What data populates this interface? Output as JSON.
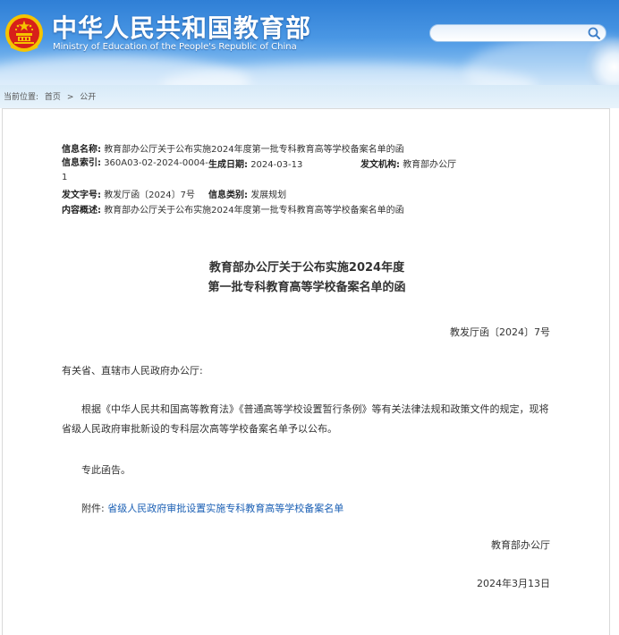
{
  "header": {
    "site_name_cn": "中华人民共和国教育部",
    "site_name_en": "Ministry of Education of the People's Republic of China",
    "search_placeholder": "",
    "search_icon": "magnifier-icon",
    "emblem_icon": "national-emblem-icon"
  },
  "breadcrumb": {
    "label": "当前位置:",
    "items": [
      "首页",
      "公开"
    ],
    "separator": ">"
  },
  "meta": {
    "name_label": "信息名称:",
    "name_value": "教育部办公厅关于公布实施2024年度第一批专科教育高等学校备案名单的函",
    "index_label": "信息索引:",
    "index_value": "360A03-02-2024-0004-1",
    "date_label": "生成日期:",
    "date_value": "2024-03-13",
    "org_label": "发文机构:",
    "org_value": "教育部办公厅",
    "docno_label": "发文字号:",
    "docno_value": "教发厅函〔2024〕7号",
    "category_label": "信息类别:",
    "category_value": "发展规划",
    "summary_label": "内容概述:",
    "summary_value": "教育部办公厅关于公布实施2024年度第一批专科教育高等学校备案名单的函"
  },
  "article": {
    "title_line1": "教育部办公厅关于公布实施2024年度",
    "title_line2": "第一批专科教育高等学校备案名单的函",
    "doc_number": "教发厅函〔2024〕7号",
    "salutation": "有关省、直辖市人民政府办公厅:",
    "paragraph1": "根据《中华人民共和国高等教育法》《普通高等学校设置暂行条例》等有关法律法规和政策文件的规定，现将省级人民政府审批新设的专科层次高等学校备案名单予以公布。",
    "paragraph2": "专此函告。",
    "attachment_label": "附件:",
    "attachment_link": "省级人民政府审批设置实施专科教育高等学校备案名单",
    "signature": "教育部办公厅",
    "date": "2024年3月13日"
  },
  "colors": {
    "header_blue": "#2f7fd6",
    "link": "#1a5fb4",
    "emblem_red": "#d7201a",
    "emblem_gold": "#f5c400"
  }
}
